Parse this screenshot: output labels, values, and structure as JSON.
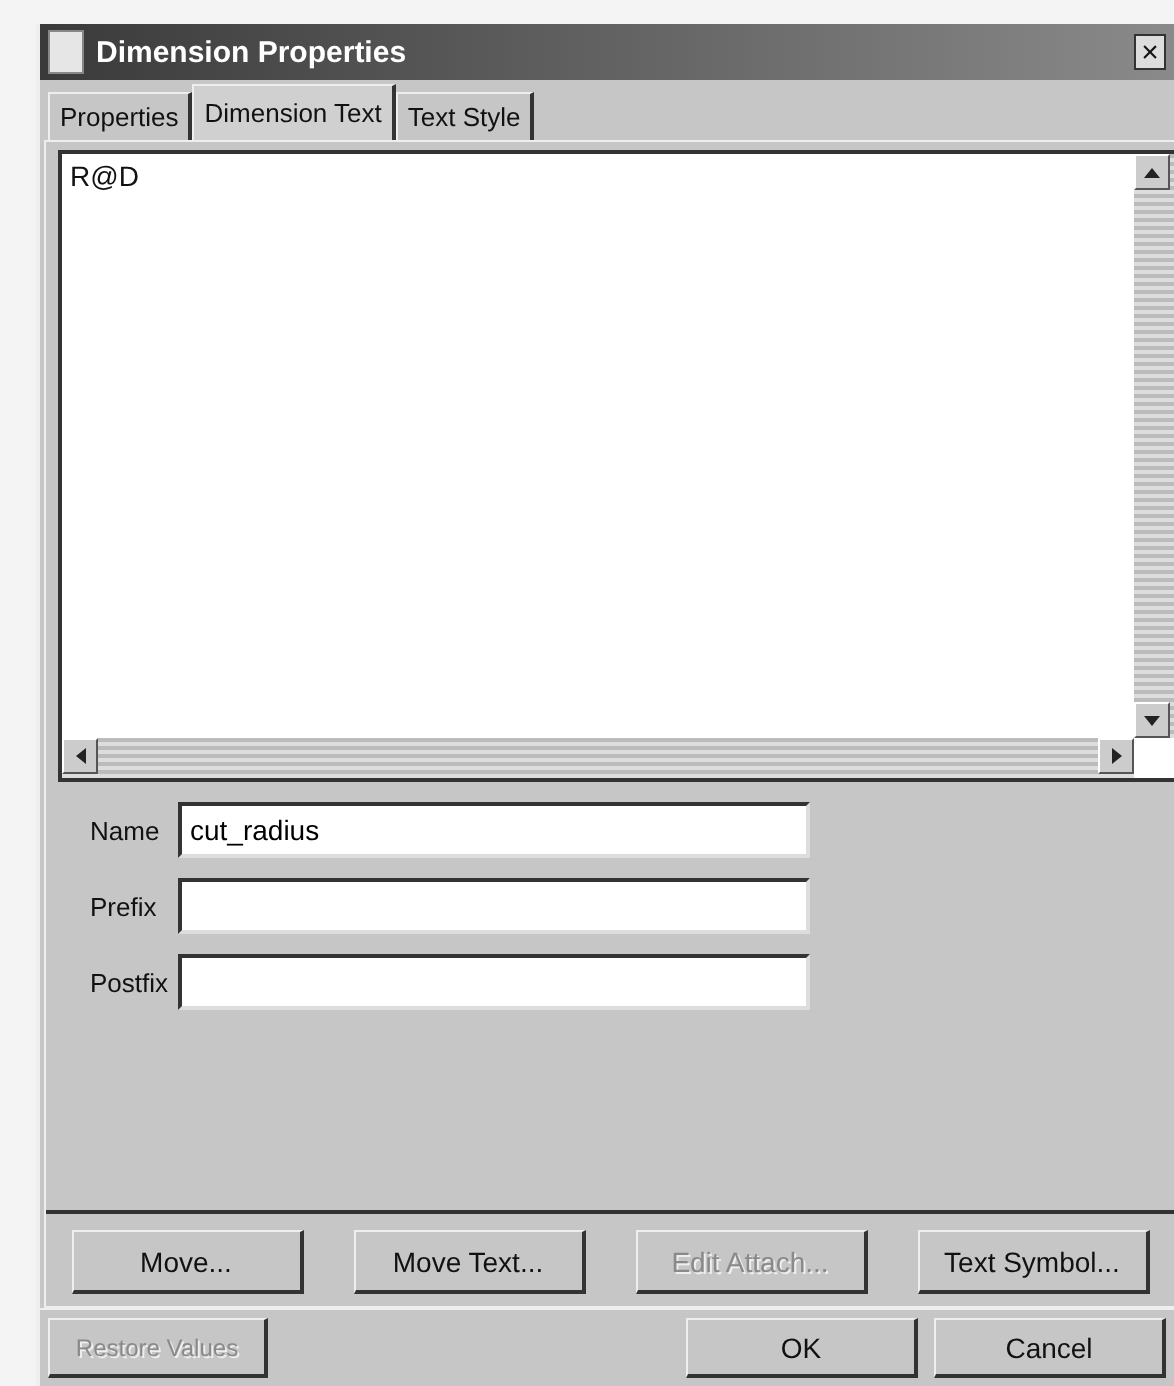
{
  "window": {
    "title": "Dimension Properties",
    "close": "×"
  },
  "tabs": [
    {
      "label": "Properties",
      "selected": false
    },
    {
      "label": "Dimension Text",
      "selected": true
    },
    {
      "label": "Text Style",
      "selected": false
    }
  ],
  "text_area": {
    "value": "R@D"
  },
  "fields": [
    {
      "label": "Name",
      "value": "cut_radius"
    },
    {
      "label": "Prefix"
    },
    {
      "label": "Postfix"
    }
  ],
  "action_buttons": [
    {
      "label": "Move...",
      "disabled": false
    },
    {
      "label": "Move Text...",
      "disabled": false
    },
    {
      "label": "Edit Attach...",
      "disabled": true
    },
    {
      "label": "Text Symbol...",
      "disabled": false
    }
  ],
  "bottom_buttons": [
    {
      "label": "Restore Values",
      "disabled": true
    },
    {
      "label": "OK",
      "disabled": false
    },
    {
      "label": "Cancel",
      "disabled": false
    }
  ]
}
